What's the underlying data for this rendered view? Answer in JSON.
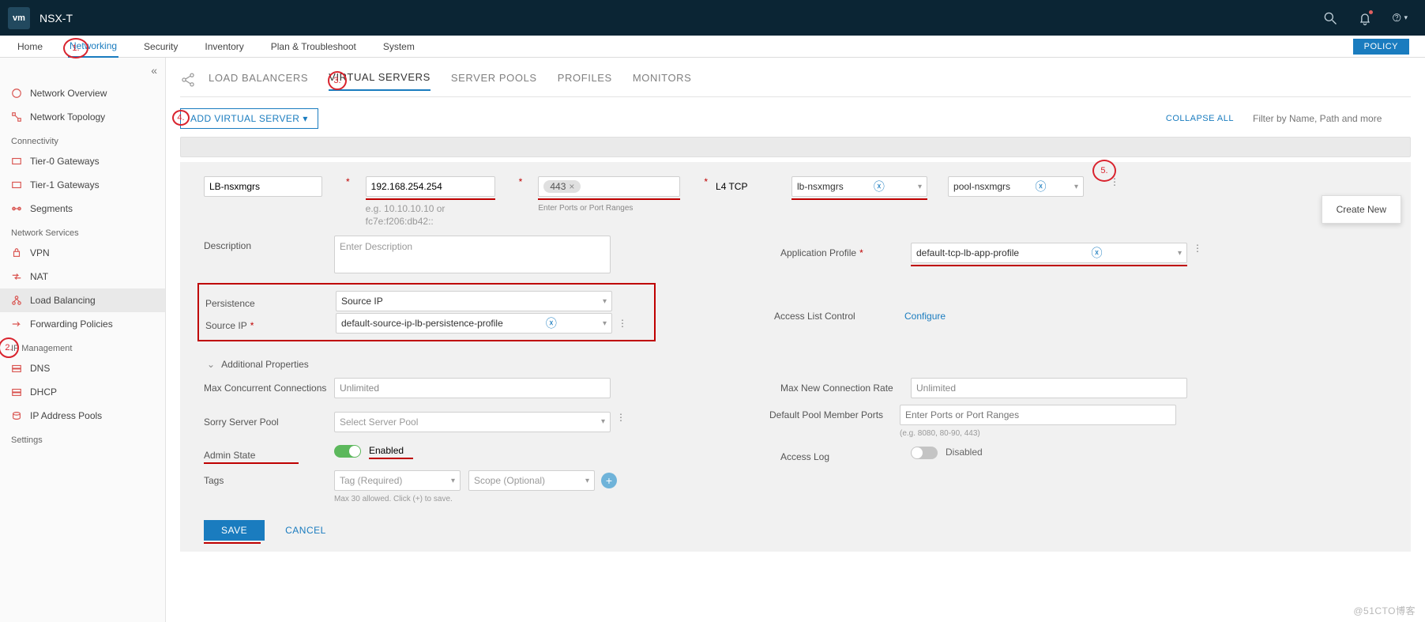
{
  "header": {
    "logo": "vm",
    "title": "NSX-T"
  },
  "nav": {
    "items": [
      "Home",
      "Networking",
      "Security",
      "Inventory",
      "Plan & Troubleshoot",
      "System"
    ],
    "active": 1,
    "badge": "POLICY"
  },
  "sidebar": {
    "sec1": [
      "Network Overview",
      "Network Topology"
    ],
    "group_conn": "Connectivity",
    "conn": [
      "Tier-0 Gateways",
      "Tier-1 Gateways",
      "Segments"
    ],
    "group_ns": "Network Services",
    "ns": [
      "VPN",
      "NAT",
      "Load Balancing",
      "Forwarding Policies"
    ],
    "ns_active": 2,
    "group_ip": "IP Management",
    "ip": [
      "DNS",
      "DHCP",
      "IP Address Pools"
    ],
    "group_set": "Settings"
  },
  "tabs": {
    "items": [
      "LOAD BALANCERS",
      "VIRTUAL SERVERS",
      "SERVER POOLS",
      "PROFILES",
      "MONITORS"
    ],
    "active": 1
  },
  "toolbar": {
    "add": "ADD VIRTUAL SERVER",
    "collapse": "COLLAPSE ALL",
    "filter_ph": "Filter by Name, Path and more"
  },
  "popover": {
    "create_new": "Create New"
  },
  "form": {
    "name": "LB-nsxmgrs",
    "ip": "192.168.254.254",
    "ip_hint1": "e.g. 10.10.10.10 or",
    "ip_hint2": "fc7e:f206:db42::",
    "port_chip": "443",
    "port_ph": "Enter Ports or Port Ranges",
    "protocol": "L4 TCP",
    "lb": "lb-nsxmgrs",
    "pool": "pool-nsxmgrs",
    "desc_label": "Description",
    "desc_ph": "Enter Description",
    "app_profile_label": "Application Profile",
    "app_profile": "default-tcp-lb-app-profile",
    "persist_label": "Persistence",
    "persist": "Source IP",
    "source_ip_label": "Source IP",
    "source_ip": "default-source-ip-lb-persistence-profile",
    "access_list_label": "Access List Control",
    "access_list": "Configure",
    "additional": "Additional Properties",
    "max_conn_label": "Max Concurrent Connections",
    "max_conn": "Unlimited",
    "max_new_label": "Max New Connection Rate",
    "max_new": "Unlimited",
    "sorry_label": "Sorry Server Pool",
    "sorry_ph": "Select Server Pool",
    "default_ports_label": "Default Pool Member Ports",
    "default_ports_ph": "Enter Ports or Port Ranges",
    "default_ports_hint": "(e.g. 8080, 80-90, 443)",
    "admin_label": "Admin State",
    "admin_val": "Enabled",
    "access_log_label": "Access Log",
    "access_log_val": "Disabled",
    "tags_label": "Tags",
    "tag_ph": "Tag (Required)",
    "scope_ph": "Scope (Optional)",
    "tags_hint": "Max 30 allowed. Click (+) to save.",
    "save": "SAVE",
    "cancel": "CANCEL"
  },
  "callouts": {
    "c1": "1.",
    "c2": "2.",
    "c3": "3.",
    "c4": "4.",
    "c5": "5."
  },
  "watermark": "@51CTO博客"
}
